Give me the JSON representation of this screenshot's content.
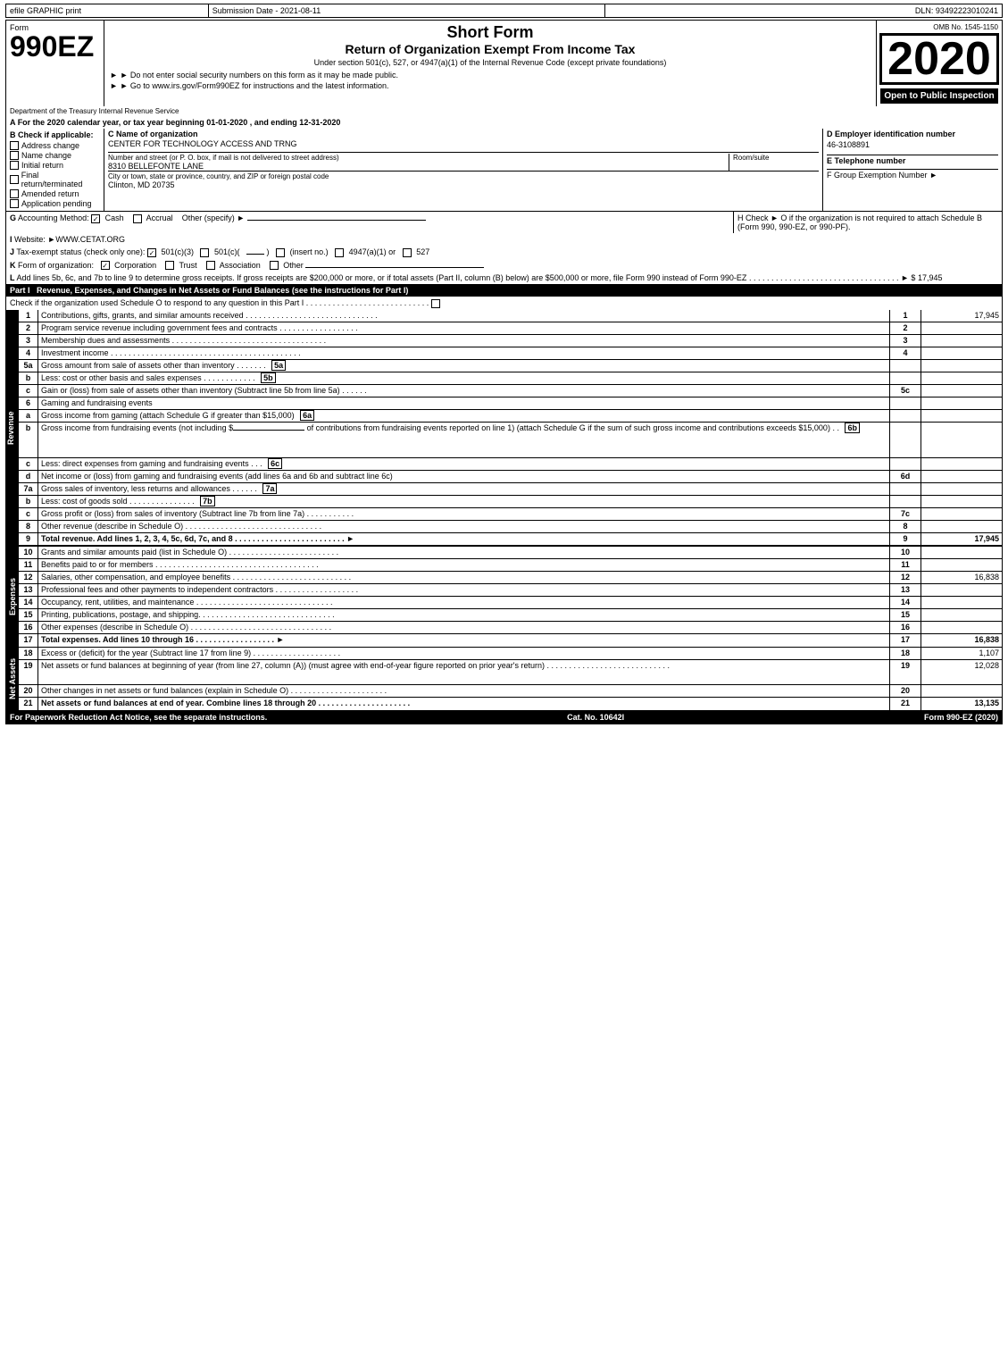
{
  "topBar": {
    "left": "efile GRAPHIC print",
    "mid": "Submission Date - 2021-08-11",
    "right": "DLN: 93492223010241"
  },
  "header": {
    "formNumber": "990EZ",
    "formLabel": "Form",
    "shortFormTitle": "Short Form",
    "returnTitle": "Return of Organization Exempt From Income Tax",
    "subtitle": "Under section 501(c), 527, or 4947(a)(1) of the Internal Revenue Code (except private foundations)",
    "notice1": "► Do not enter social security numbers on this form as it may be made public.",
    "notice2": "► Go to www.irs.gov/Form990EZ for instructions and the latest information.",
    "year": "2020",
    "omb": "OMB No. 1545-1150",
    "openPublic": "Open to Public Inspection",
    "dept1": "Department of the Treasury",
    "dept2": "Internal Revenue",
    "dept3": "Service"
  },
  "sectionA": {
    "label": "A",
    "text": "For the 2020 calendar year, or tax year beginning 01-01-2020 , and ending 12-31-2020"
  },
  "sectionB": {
    "label": "B",
    "checkLabel": "Check if applicable:",
    "checks": [
      {
        "id": "address-change",
        "label": "Address change"
      },
      {
        "id": "name-change",
        "label": "Name change"
      },
      {
        "id": "initial-return",
        "label": "Initial return"
      },
      {
        "id": "final-return",
        "label": "Final return/terminated"
      },
      {
        "id": "amended-return",
        "label": "Amended return"
      },
      {
        "id": "application-pending",
        "label": "Application pending"
      }
    ],
    "cLabel": "C Name of organization",
    "orgName": "CENTER FOR TECHNOLOGY ACCESS AND TRNG",
    "streetLabel": "Number and street (or P. O. box, if mail is not delivered to street address)",
    "streetValue": "8310 BELLEFONTE LANE",
    "roomLabel": "Room/suite",
    "cityLabel": "City or town, state or province, country, and ZIP or foreign postal code",
    "cityValue": "Clinton, MD  20735",
    "dLabel": "D Employer identification number",
    "ein": "46-3108891",
    "eLabel": "E Telephone number",
    "fLabel": "F Group Exemption Number",
    "fArrow": "►"
  },
  "sectionG": {
    "label": "G",
    "text": "Accounting Method:",
    "cashLabel": "Cash",
    "cashChecked": true,
    "accrualLabel": "Accrual",
    "accrualChecked": false,
    "otherLabel": "Other (specify) ►",
    "hText": "H  Check ►  O if the organization is not required to attach Schedule B (Form 990, 990-EZ, or 990-PF)."
  },
  "sectionI": {
    "label": "I",
    "text": "Website: ►WWW.CETAT.ORG"
  },
  "sectionJ": {
    "label": "J",
    "text": "Tax-exempt status (check only one):",
    "options": [
      "501(c)(3)",
      "501(c)(",
      ")",
      "(insert no.)",
      "4947(a)(1) or",
      "527"
    ],
    "checked501c3": true
  },
  "sectionK": {
    "label": "K",
    "text": "Form of organization:",
    "options": [
      "Corporation",
      "Trust",
      "Association",
      "Other"
    ],
    "checkedCorp": true
  },
  "sectionL": {
    "label": "L",
    "text": "Add lines 5b, 6c, and 7b to line 9 to determine gross receipts. If gross receipts are $200,000 or more, or if total assets (Part II, column (B) below) are $500,000 or more, file Form 990 instead of Form 990-EZ",
    "dots": ". . . . . . . . . . . . . . . . . . . . . . . . . . . . . . . . . .",
    "arrow": "► $",
    "amount": "17,945"
  },
  "partI": {
    "title": "Part I",
    "titleFull": "Revenue, Expenses, and Changes in Net Assets or Fund Balances",
    "subtitle": "(see the instructions for Part I)",
    "checkLine": "Check if the organization used Schedule O to respond to any question in this Part I",
    "checkDots": ". . . . . . . . . . . . . . . . . . . . . . . . . . . .",
    "checkBox": "O",
    "sideLabel": "Revenue",
    "lines": [
      {
        "num": "1",
        "desc": "Contributions, gifts, grants, and similar amounts received",
        "dots": ". . . . . . . . . . . . . . . . . . . . . . . . . . . . . .",
        "lineRef": "1",
        "amount": "17,945"
      },
      {
        "num": "2",
        "desc": "Program service revenue including government fees and contracts",
        "dots": ". . . . . . . . . . . . . . . . . .",
        "lineRef": "2",
        "amount": ""
      },
      {
        "num": "3",
        "desc": "Membership dues and assessments",
        "dots": ". . . . . . . . . . . . . . . . . . . . . . . . . . . . . . . . . . .",
        "lineRef": "3",
        "amount": ""
      },
      {
        "num": "4",
        "desc": "Investment income",
        "dots": ". . . . . . . . . . . . . . . . . . . . . . . . . . . . . . . . . . . . . . . . . . .",
        "lineRef": "4",
        "amount": ""
      },
      {
        "num": "5a",
        "desc": "Gross amount from sale of assets other than inventory",
        "dots": ". . . . . . .",
        "subRef": "5a",
        "amount": ""
      },
      {
        "num": "b",
        "desc": "Less: cost or other basis and sales expenses",
        "dots": ". . . . . . . . . . . .",
        "subRef": "5b",
        "amount": ""
      },
      {
        "num": "c",
        "desc": "Gain or (loss) from sale of assets other than inventory (Subtract line 5b from line 5a)",
        "dots": ". . . . . .",
        "lineRef": "5c",
        "amount": ""
      },
      {
        "num": "6",
        "desc": "Gaming and fundraising events",
        "dots": "",
        "lineRef": "",
        "amount": ""
      },
      {
        "num": "a",
        "desc": "Gross income from gaming (attach Schedule G if greater than $15,000)",
        "subRef": "6a",
        "amount": ""
      },
      {
        "num": "b",
        "desc": "Gross income from fundraising events (not including $                    of contributions from fundraising events reported on line 1) (attach Schedule G if the sum of such gross income and contributions exceeds $15,000)",
        "dots": "  .  .",
        "subRef": "6b",
        "amount": ""
      },
      {
        "num": "c",
        "desc": "Less: direct expenses from gaming and fundraising events   .   .   .",
        "subRef": "6c",
        "amount": ""
      },
      {
        "num": "d",
        "desc": "Net income or (loss) from gaming and fundraising events (add lines 6a and 6b and subtract line 6c)",
        "lineRef": "6d",
        "amount": ""
      },
      {
        "num": "7a",
        "desc": "Gross sales of inventory, less returns and allowances",
        "dots": ". . . . . .",
        "subRef": "7a",
        "amount": ""
      },
      {
        "num": "b",
        "desc": "Less: cost of goods sold   .   .   .   .   .   .   .   .   .   .   .   .   .   .   .",
        "subRef": "7b",
        "amount": ""
      },
      {
        "num": "c",
        "desc": "Gross profit or (loss) from sales of inventory (Subtract line 7b from line 7a)",
        "dots": ". . . . . . . . . . .",
        "lineRef": "7c",
        "amount": ""
      },
      {
        "num": "8",
        "desc": "Other revenue (describe in Schedule O)",
        "dots": ". . . . . . . . . . . . . . . . . . . . . . . . . . . . . . .",
        "lineRef": "8",
        "amount": ""
      },
      {
        "num": "9",
        "desc": "Total revenue. Add lines 1, 2, 3, 4, 5c, 6d, 7c, and 8",
        "dots": ". . . . . . . . . . . . . . . . . . . . . . . . . .",
        "arrow": "►",
        "lineRef": "9",
        "amount": "17,945",
        "bold": true
      }
    ],
    "expensesLabel": "Expenses",
    "expenseLines": [
      {
        "num": "10",
        "desc": "Grants and similar amounts paid (list in Schedule O)",
        "dots": ". . . . . . . . . . . . . . . . . . . . . . . . . .",
        "lineRef": "10",
        "amount": ""
      },
      {
        "num": "11",
        "desc": "Benefits paid to or for members",
        "dots": ". . . . . . . . . . . . . . . . . . . . . . . . . . . . . . . . . . . . .",
        "lineRef": "11",
        "amount": ""
      },
      {
        "num": "12",
        "desc": "Salaries, other compensation, and employee benefits",
        "dots": ". . . . . . . . . . . . . . . . . . . . . . . . . . .",
        "lineRef": "12",
        "amount": "16,838"
      },
      {
        "num": "13",
        "desc": "Professional fees and other payments to independent contractors",
        "dots": ". . . . . . . . . . . . . . . . . . .",
        "lineRef": "13",
        "amount": ""
      },
      {
        "num": "14",
        "desc": "Occupancy, rent, utilities, and maintenance",
        "dots": ". . . . . . . . . . . . . . . . . . . . . . . . . . . . . . . . .",
        "lineRef": "14",
        "amount": ""
      },
      {
        "num": "15",
        "desc": "Printing, publications, postage, and shipping.",
        "dots": ". . . . . . . . . . . . . . . . . . . . . . . . . . . . . . .",
        "lineRef": "15",
        "amount": ""
      },
      {
        "num": "16",
        "desc": "Other expenses (describe in Schedule O)",
        "dots": ". . . . . . . . . . . . . . . . . . . . . . . . . . . . . . . . .",
        "lineRef": "16",
        "amount": ""
      },
      {
        "num": "17",
        "desc": "Total expenses. Add lines 10 through 16",
        "dots": "  .   .   .   .   .   .   .   .   .   .   .   .   .   .   .   .   .   .",
        "arrow": "►",
        "lineRef": "17",
        "amount": "16,838",
        "bold": true
      }
    ],
    "netAssetsLabel": "Net Assets",
    "netAssetLines": [
      {
        "num": "18",
        "desc": "Excess or (deficit) for the year (Subtract line 17 from line 9)",
        "dots": "  .   .   .   .   .   .   .   .   .   .   .   .   .   .   .   .   .   .   .   .",
        "lineRef": "18",
        "amount": "1,107"
      },
      {
        "num": "19",
        "desc": "Net assets or fund balances at beginning of year (from line 27, column (A)) (must agree with end-of-year figure reported on prior year's return)",
        "dots": ". . . . . . . . . . . . . . . . . . . . . . . . . . . .",
        "lineRef": "19",
        "amount": "12,028"
      },
      {
        "num": "20",
        "desc": "Other changes in net assets or fund balances (explain in Schedule O)",
        "dots": ". . . . . . . . . . . . . . . . . . . . . . .",
        "lineRef": "20",
        "amount": ""
      },
      {
        "num": "21",
        "desc": "Net assets or fund balances at end of year. Combine lines 18 through 20",
        "dots": ". . . . . . . . . . . . . . . . . . . . . .",
        "lineRef": "21",
        "amount": "13,135",
        "bold": true
      }
    ]
  },
  "footer": {
    "paperworkText": "For Paperwork Reduction Act Notice, see the separate instructions.",
    "catNo": "Cat. No. 10642I",
    "formRef": "Form 990-EZ (2020)"
  }
}
